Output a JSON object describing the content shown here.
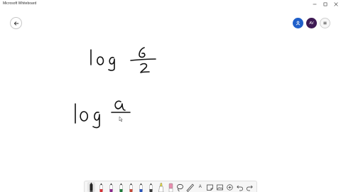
{
  "window": {
    "title": "Microsoft Whiteboard"
  },
  "header": {
    "avatar_initials": "AV"
  },
  "canvas": {
    "colors": {
      "ink": "#111111"
    }
  },
  "toolbar": {
    "text_tool_label": "A",
    "pen_colors": [
      "#222222",
      "#d13438",
      "#8b2a8b",
      "#1f7a3a",
      "#c04a3a",
      "#2b55b8",
      "#3a3a3a"
    ],
    "highlighter_color": "#e8df3a",
    "active_tool": "pen-black"
  }
}
